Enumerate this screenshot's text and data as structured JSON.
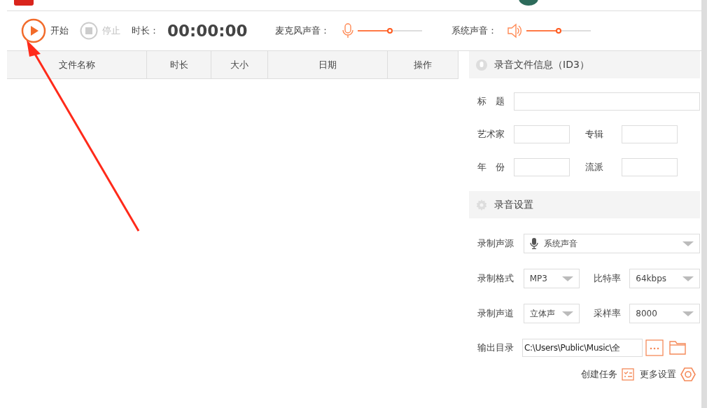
{
  "toolbar": {
    "buttons": [
      {
        "label": "开始",
        "disabled": false
      },
      {
        "label": "停止",
        "disabled": true
      }
    ],
    "duration_label": "时长：",
    "duration": "00:00:00",
    "volumes": [
      {
        "label": "麦克风声音：",
        "kind": "mic",
        "level": 0.49
      },
      {
        "label": "系统声音：",
        "kind": "speaker",
        "level": 0.49
      }
    ]
  },
  "table": {
    "columns": [
      "文件名称",
      "时长",
      "大小",
      "日期",
      "操作"
    ]
  },
  "id3": {
    "title": "录音文件信息（ID3）",
    "rows": [
      [
        {
          "label": "标　题"
        }
      ],
      [
        {
          "label": "艺术家"
        },
        {
          "label": "专辑"
        }
      ],
      [
        {
          "label": "年　份"
        },
        {
          "label": "流派"
        }
      ]
    ]
  },
  "settings": {
    "title": "录音设置",
    "source": {
      "label": "录制声源",
      "value": "系统声音"
    },
    "rows": [
      [
        {
          "label": "录制格式",
          "value": "MP3"
        },
        {
          "label": "比特率",
          "value": "64kbps"
        }
      ],
      [
        {
          "label": "录制声道",
          "value": "立体声"
        },
        {
          "label": "采样率",
          "value": "8000"
        }
      ]
    ],
    "output": {
      "label": "输出目录",
      "value": "C:\\Users\\Public\\Music\\全"
    },
    "actions": [
      "创建任务",
      "更多设置"
    ]
  }
}
